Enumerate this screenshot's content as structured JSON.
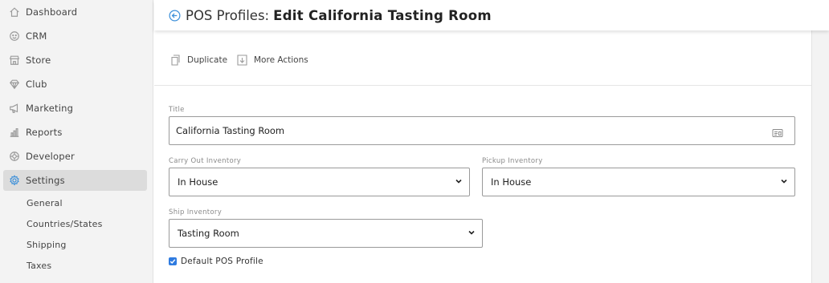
{
  "sidebar": {
    "items": [
      {
        "label": "Dashboard",
        "icon": "home-icon"
      },
      {
        "label": "CRM",
        "icon": "smiley-icon"
      },
      {
        "label": "Store",
        "icon": "store-icon"
      },
      {
        "label": "Club",
        "icon": "diamond-icon"
      },
      {
        "label": "Marketing",
        "icon": "megaphone-icon"
      },
      {
        "label": "Reports",
        "icon": "bar-chart-icon"
      },
      {
        "label": "Developer",
        "icon": "developer-icon"
      },
      {
        "label": "Settings",
        "icon": "gear-icon",
        "active": true
      }
    ],
    "sub_items": [
      "General",
      "Countries/States",
      "Shipping",
      "Taxes"
    ]
  },
  "header": {
    "prefix": "POS Profiles:",
    "title": "Edit California Tasting Room"
  },
  "actions": {
    "duplicate": "Duplicate",
    "more_actions": "More Actions"
  },
  "form": {
    "title_label": "Title",
    "title_value": "California Tasting Room",
    "carry_out_label": "Carry Out Inventory",
    "carry_out_value": "In House",
    "pickup_label": "Pickup Inventory",
    "pickup_value": "In House",
    "ship_label": "Ship Inventory",
    "ship_value": "Tasting Room",
    "default_label": "Default POS Profile",
    "default_checked": true
  },
  "colors": {
    "accent": "#3b8fd9",
    "checkbox": "#2f7be0",
    "sidebar_bg": "#f3f3f3",
    "active_bg": "#dcdcdc"
  }
}
